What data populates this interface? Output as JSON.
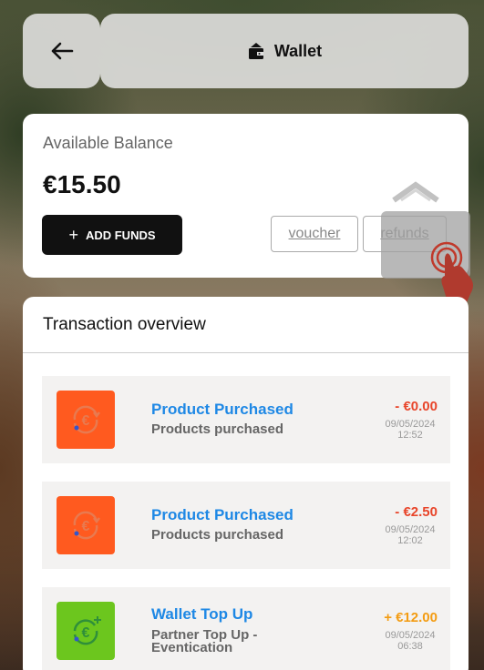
{
  "header": {
    "title": "Wallet",
    "back_icon": "arrow-left-icon",
    "wallet_icon": "wallet-icon"
  },
  "balance": {
    "label": "Available Balance",
    "amount": "€15.50",
    "add_funds_label": "ADD FUNDS",
    "voucher_label": "voucher",
    "refunds_label": "refunds"
  },
  "transactions": {
    "heading": "Transaction overview",
    "items": [
      {
        "title": "Product Purchased",
        "subtitle": "Products purchased",
        "amount": "- €0.00",
        "date": "09/05/2024",
        "time": "12:52",
        "type": "purchase",
        "icon_color": "#ff5a1f",
        "amount_color": "#e8452a"
      },
      {
        "title": "Product Purchased",
        "subtitle": "Products purchased",
        "amount": "- €2.50",
        "date": "09/05/2024",
        "time": "12:02",
        "type": "purchase",
        "icon_color": "#ff5a1f",
        "amount_color": "#e8452a"
      },
      {
        "title": "Wallet Top Up",
        "subtitle": "Partner Top Up - Eventication",
        "amount": "+ €12.00",
        "date": "09/05/2024",
        "time": "06:38",
        "type": "topup",
        "icon_color": "#6cc61e",
        "amount_color": "#f39c12"
      }
    ]
  },
  "colors": {
    "accent_blue": "#1e88e5",
    "negative": "#e8452a",
    "positive": "#f39c12"
  }
}
